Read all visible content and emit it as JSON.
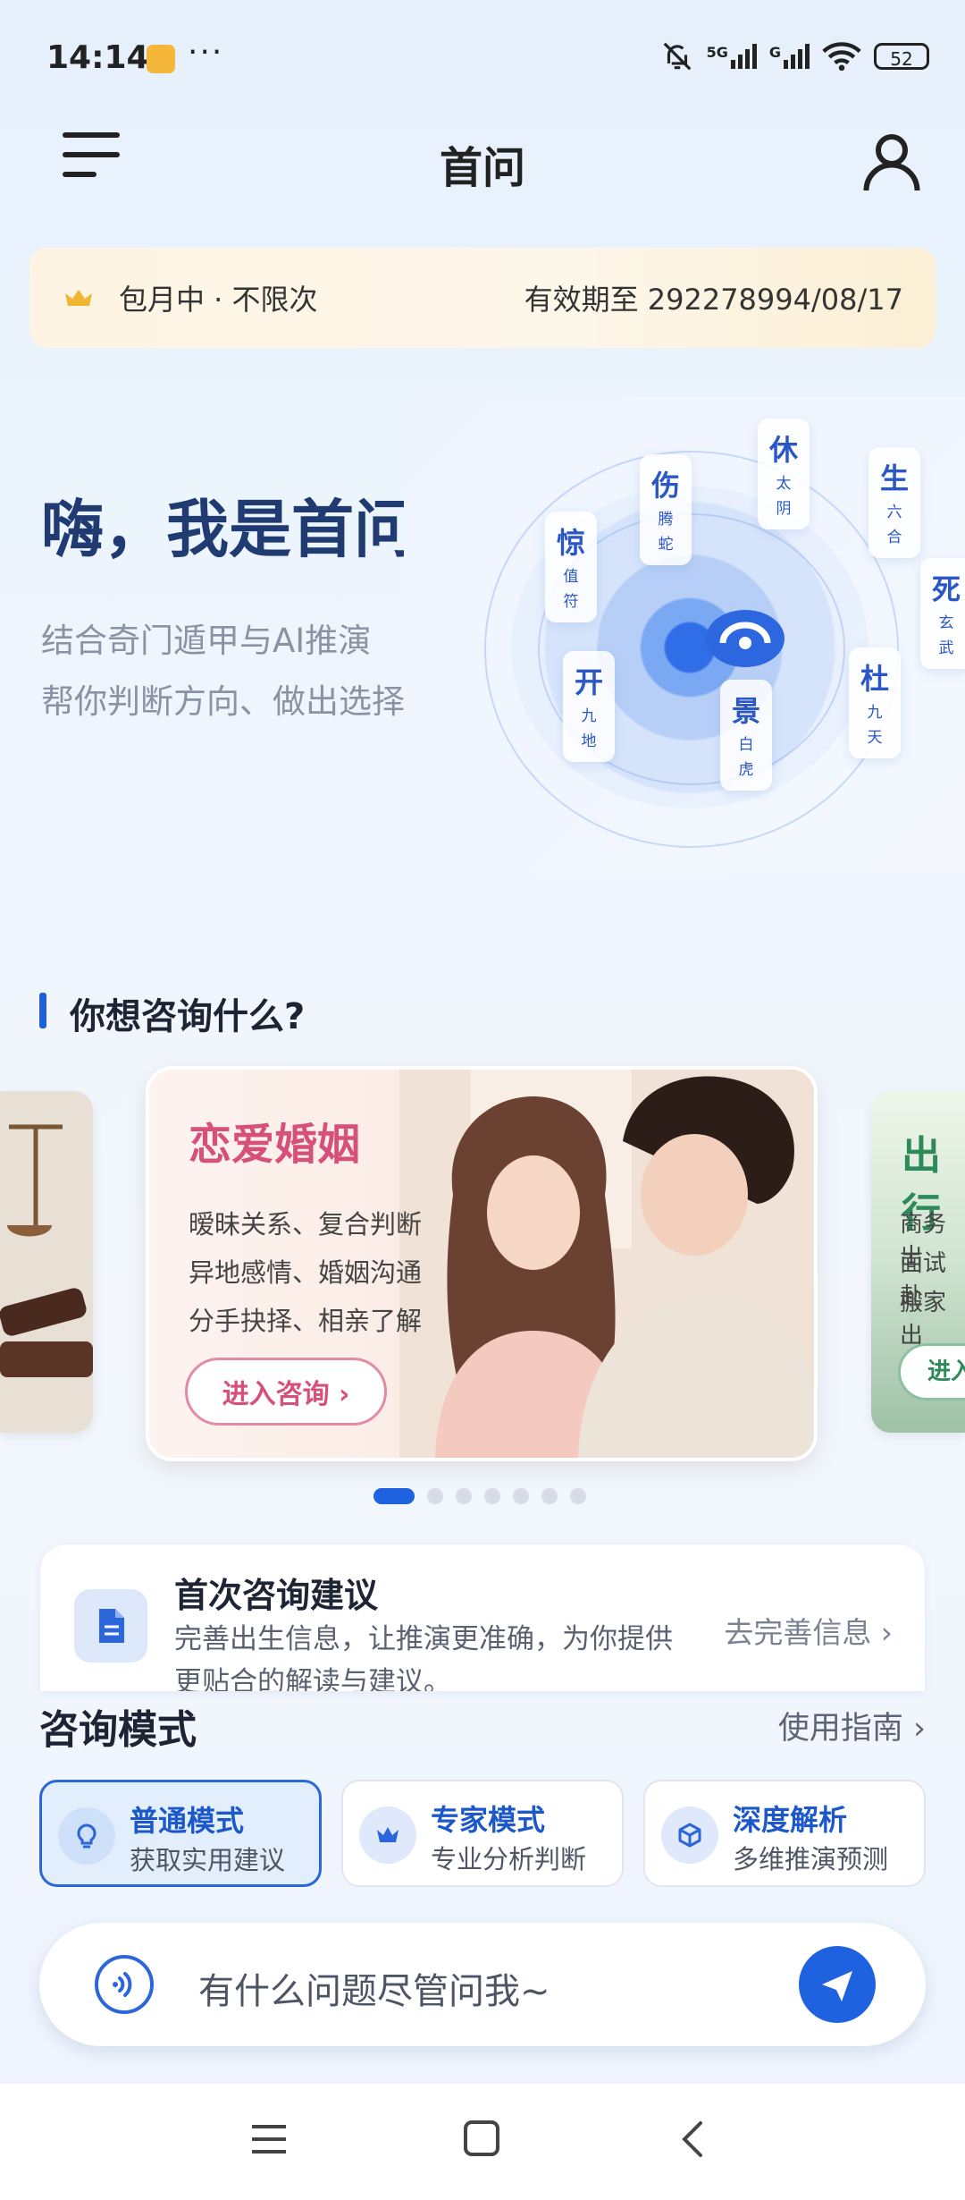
{
  "status": {
    "time": "14:14",
    "more": "···",
    "network_5g": "5G",
    "network_g": "G",
    "battery": "52"
  },
  "header": {
    "title": "首问",
    "menu_icon": "menu-icon",
    "user_icon": "user-icon"
  },
  "membership": {
    "status": "包月中 · 不限次",
    "expiry": "有效期至 292278994/08/17"
  },
  "hero": {
    "title": "嗨，我是首问",
    "subtitle_1": "结合奇门遁甲与AI推演",
    "subtitle_2": "帮你判断方向、做出选择",
    "gua": [
      {
        "big": "惊",
        "s1": "值",
        "s2": "符"
      },
      {
        "big": "伤",
        "s1": "腾",
        "s2": "蛇"
      },
      {
        "big": "休",
        "s1": "太",
        "s2": "阴"
      },
      {
        "big": "生",
        "s1": "六",
        "s2": "合"
      },
      {
        "big": "死",
        "s1": "玄",
        "s2": "武"
      },
      {
        "big": "杜",
        "s1": "九",
        "s2": "天"
      },
      {
        "big": "景",
        "s1": "白",
        "s2": "虎"
      },
      {
        "big": "开",
        "s1": "九",
        "s2": "地"
      }
    ]
  },
  "section": {
    "title": "你想咨询什么?"
  },
  "carousel": {
    "main": {
      "title": "恋爱婚姻",
      "lines": [
        "暧昧关系、复合判断",
        "异地感情、婚姻沟通",
        "分手抉择、相亲了解"
      ],
      "button": "进入咨询 ›"
    },
    "right": {
      "title": "出行",
      "lines": [
        "商务出",
        "面试赴",
        "搬家出"
      ],
      "button": "进入"
    },
    "dots_total": 7,
    "active_index": 0
  },
  "advice": {
    "title": "首次咨询建议",
    "desc": "完善出生信息，让推演更准确，为你提供更贴合的解读与建议。",
    "link": "去完善信息 ›"
  },
  "mode": {
    "title": "咨询模式",
    "guide": "使用指南 ›",
    "options": [
      {
        "name": "普通模式",
        "desc": "获取实用建议",
        "icon": "lightbulb-icon",
        "active": true
      },
      {
        "name": "专家模式",
        "desc": "专业分析判断",
        "icon": "crown-icon",
        "active": false
      },
      {
        "name": "深度解析",
        "desc": "多维推演预测",
        "icon": "cube-icon",
        "active": false
      }
    ]
  },
  "ask": {
    "placeholder": "有什么问题尽管问我~"
  },
  "colors": {
    "accent": "#1f62e0",
    "title_blue": "#1f3b72",
    "love_pink": "#d6517a",
    "travel_green": "#2f8a5b"
  }
}
